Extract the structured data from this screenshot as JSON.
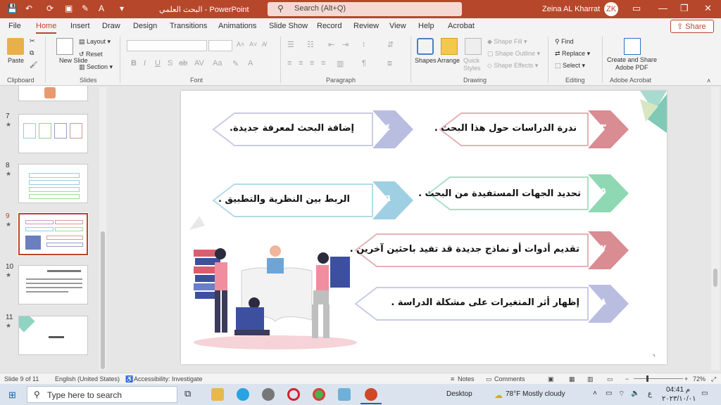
{
  "titlebar": {
    "title": "البحث العلمي  -  PowerPoint",
    "search_placeholder": "Search (Alt+Q)",
    "user_name": "Zeina AL Kharrat",
    "avatar_initials": "ZK"
  },
  "tabs": [
    "File",
    "Home",
    "Insert",
    "Draw",
    "Design",
    "Transitions",
    "Animations",
    "Slide Show",
    "Record",
    "Review",
    "View",
    "Help",
    "Acrobat"
  ],
  "share_label": "Share",
  "ribbon": {
    "clipboard": {
      "paste": "Paste",
      "label": "Clipboard"
    },
    "slides": {
      "new_slide": "New Slide",
      "layout": "Layout",
      "reset": "Reset",
      "section": "Section",
      "label": "Slides"
    },
    "font": {
      "label": "Font"
    },
    "paragraph": {
      "label": "Paragraph"
    },
    "drawing": {
      "shapes": "Shapes",
      "arrange": "Arrange",
      "quick_styles": "Quick Styles",
      "shape_fill": "Shape Fill",
      "shape_outline": "Shape Outline",
      "shape_effects": "Shape Effects",
      "label": "Drawing"
    },
    "editing": {
      "find": "Find",
      "replace": "Replace",
      "select": "Select",
      "label": "Editing"
    },
    "acrobat": {
      "create": "Create and Share",
      "create2": "Adobe PDF",
      "label": "Adobe Acrobat"
    }
  },
  "thumbnails": [
    {
      "num": "7",
      "star": "★"
    },
    {
      "num": "8",
      "star": "★"
    },
    {
      "num": "9",
      "star": "★"
    },
    {
      "num": "10",
      "star": "★"
    },
    {
      "num": "11",
      "star": "★"
    }
  ],
  "slide": {
    "items": [
      {
        "num": "٣",
        "text": "ندرة الدراسات حول هذا البحث .",
        "color": "#d98c92"
      },
      {
        "num": "٤",
        "text": "إضافة البحث لمعرفة جديدة.",
        "color": "#b9bde0"
      },
      {
        "num": "٥",
        "text": "تحديد الجهات المستفيدة من البحث .",
        "color": "#8ed8b3"
      },
      {
        "num": "٦",
        "text": "الربط بين النظرية والتطبيق .",
        "color": "#9fcfe2"
      },
      {
        "num": "٧",
        "text": "تقديم أدوات أو نماذج جديدة قد تفيد باحثين آخرين .",
        "color": "#d98c92"
      },
      {
        "num": "٨",
        "text": "إظهار أثر المتغيرات على مشكلة الدراسة .",
        "color": "#b9bde0"
      }
    ],
    "page_number": "٩"
  },
  "statusbar": {
    "slide_info": "Slide 9 of 11",
    "language": "English (United States)",
    "accessibility": "Accessibility: Investigate",
    "notes": "Notes",
    "comments": "Comments",
    "zoom": "72%"
  },
  "taskbar": {
    "search_placeholder": "Type here to search",
    "desktop": "Desktop",
    "weather": "78°F  Mostly cloudy",
    "time": "04:41 م",
    "date": "٢٠٢٣/١٠/٠١",
    "lang": "ع"
  }
}
